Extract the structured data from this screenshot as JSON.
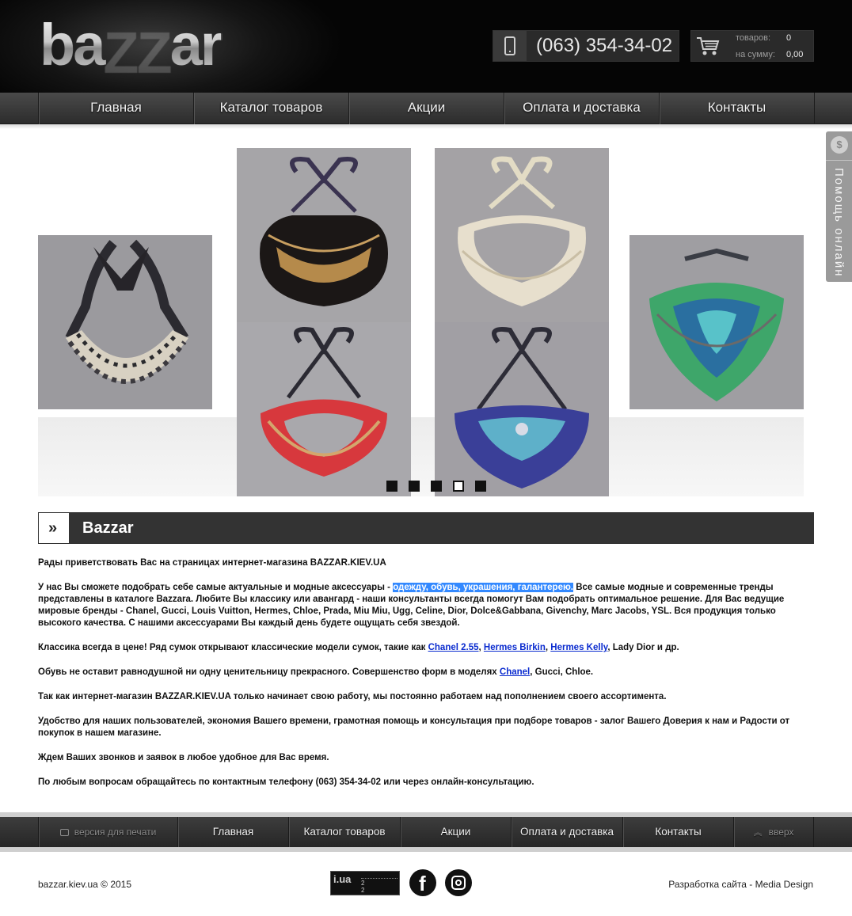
{
  "header": {
    "logo_text_before": "ba",
    "logo_text_mid": "ZZ",
    "logo_text_after": "ar",
    "phone": "(063) 354-34-02",
    "phone_icon": "mobile-phone-icon",
    "cart_icon": "shopping-cart-icon",
    "cart": {
      "items_label": "товаров:",
      "items_value": "0",
      "sum_label": "на сумму:",
      "sum_value": "0,00"
    }
  },
  "nav": {
    "items": [
      "Главная",
      "Каталог товаров",
      "Акции",
      "Оплата и доставка",
      "Контакты"
    ]
  },
  "help_tab": {
    "label": "Помощь онлайн",
    "icon": "dollar-coin-icon",
    "icon_glyph": "$"
  },
  "slider": {
    "slides": 5,
    "active_index": 3,
    "images": [
      "black-white-bib-necklace",
      "black-gold-beaded-collar",
      "cream-pearl-collar",
      "red-gold-beaded-collar",
      "blue-beaded-collar",
      "green-teal-beaded-necklace"
    ]
  },
  "page": {
    "title": "Bazzar",
    "title_icon": "double-chevron-right-icon",
    "title_icon_glyph": "»",
    "p1": "Рады приветствовать Вас на страницах интернет-магазина BAZZAR.KIEV.UA",
    "p2_a": "У нас Вы сможете подобрать себе самые актуальные и модные аксессуары - ",
    "p2_highlight": "одежду, обувь, украшения, галантерею.",
    "p2_b": " Все самые модные и современные тренды представлены в каталоге Bazzara. Любите Вы классику или авангард - наши консультанты всегда помогут Вам подобрать оптимальное решение. Для Вас ведущие мировые бренды - Chanel, Gucci, Louis Vuitton, Hermes, Chloe, Prada, Miu Miu, Ugg, Celine, Dior, Dolce&Gabbana, Givenchy, Marc Jacobs, YSL. Вся продукция только высокого качества. С  нашими аксессуарами Вы каждый день будете ощущать себя звездой.",
    "p3_a": "Классика всегда в цене! Ряд сумок открывают классические модели сумок, такие как ",
    "p3_link1": "Chanel 2.55",
    "p3_sep1": ", ",
    "p3_link2": "Hermes Birkin",
    "p3_sep2": ", ",
    "p3_link3": "Hermes Kelly",
    "p3_b": ", Lady Dior и др.",
    "p4_a": "Обувь не оставит равнодушной ни одну ценительницу прекрасного. Совершенство форм в моделях ",
    "p4_link": "Chanel",
    "p4_b": ", Gucci, Chloe.",
    "p5": "Так как интернет-магазин BAZZAR.KIEV.UA только начинает свою работу, мы постоянно работаем над пополнением своего ассортимента.",
    "p6": "Удобство для наших пользователей, экономия Вашего времени, грамотная помощь и консультация при подборе товаров - залог Вашего Доверия  к нам и Радости от покупок в нашем магазине.",
    "p7": "Ждем Ваших звонков и заявок в любое удобное для Вас время.",
    "p8": "По любым вопросам обращайтесь по контактным телефону (063) 354-34-02 или через онлайн-консультацию."
  },
  "footer_nav": {
    "print": "версия для печати",
    "print_icon": "printer-icon",
    "items": [
      "Главная",
      "Каталог товаров",
      "Акции",
      "Оплата и доставка",
      "Контакты"
    ],
    "up": "вверх",
    "up_icon": "double-chevron-up-icon",
    "up_glyph": "︽"
  },
  "bottom": {
    "copyright": "bazzar.kiev.ua © 2015",
    "counter_logo": "i.ua",
    "counter_val1": "2",
    "counter_val2": "2",
    "facebook_glyph": "f",
    "dev_prefix": "Разработка сайта - ",
    "dev_link": "Media Design"
  }
}
